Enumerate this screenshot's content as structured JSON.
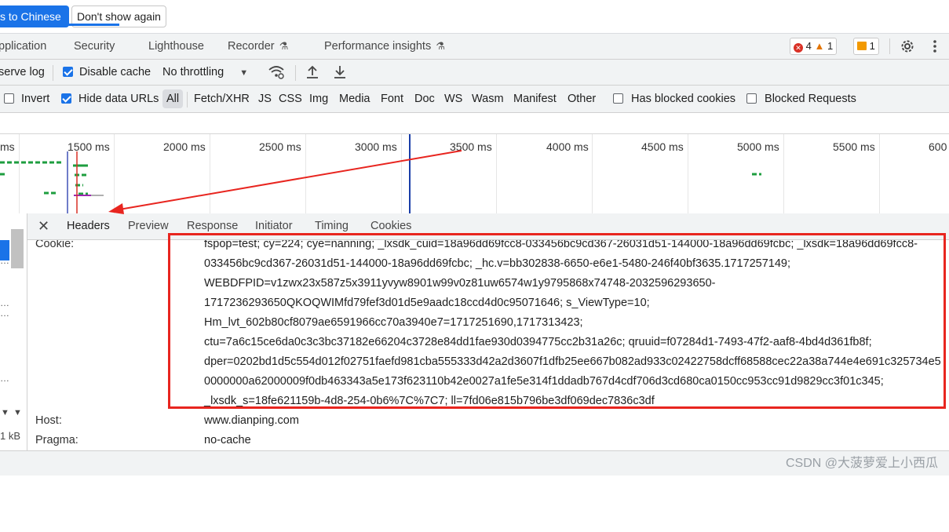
{
  "banner": {
    "switch_label": "s to Chinese",
    "dont_show_label": "Don't show again"
  },
  "panel_tabs": {
    "application": "pplication",
    "security": "Security",
    "lighthouse": "Lighthouse",
    "recorder": "Recorder",
    "performance_insights": "Performance insights",
    "errors_count": "4",
    "warnings_count": "1",
    "issues_count": "1"
  },
  "toolbar": {
    "preserve_log": "serve log",
    "disable_cache": "Disable cache",
    "throttling": "No throttling"
  },
  "filters": {
    "invert": "Invert",
    "hide_data_urls": "Hide data URLs",
    "all": "All",
    "types": [
      "Fetch/XHR",
      "JS",
      "CSS",
      "Img",
      "Media",
      "Font",
      "Doc",
      "WS",
      "Wasm",
      "Manifest",
      "Other"
    ],
    "has_blocked_cookies": "Has blocked cookies",
    "blocked_requests": "Blocked Requests"
  },
  "timeline": {
    "ticks": [
      "ms",
      "1500 ms",
      "2000 ms",
      "2500 ms",
      "3000 ms",
      "3500 ms",
      "4000 ms",
      "4500 ms",
      "5000 ms",
      "5500 ms",
      "600"
    ]
  },
  "detail_tabs": {
    "headers": "Headers",
    "preview": "Preview",
    "response": "Response",
    "initiator": "Initiator",
    "timing": "Timing",
    "cookies": "Cookies"
  },
  "left_list": {
    "size_text": "1 kB"
  },
  "headers": {
    "cookie_key": "Cookie:",
    "cookie_lines": [
      "fspop=test; cy=224; cye=nanning; _lxsdk_cuid=18a96dd69fcc8-033456bc9cd367-26031d51-144000-18a96dd69fcbc; _lxsdk=18a96dd69fcc8-",
      "033456bc9cd367-26031d51-144000-18a96dd69fcbc; _hc.v=bb302838-6650-e6e1-5480-246f40bf3635.1717257149;",
      "WEBDFPID=v1zwx23x587z5x3911yvyw8901w99v0z81uw6574w1y9795868x74748-2032596293650-",
      "1717236293650QKOQWIMfd79fef3d01d5e9aadc18ccd4d0c95071646; s_ViewType=10;",
      "Hm_lvt_602b80cf8079ae6591966cc70a3940e7=1717251690,1717313423;",
      "ctu=7a6c15ce6da0c3c3bc37182e66204c3728e84dd1fae930d0394775cc2b31a26c; qruuid=f07284d1-7493-47f2-aaf8-4bd4d361fb8f;",
      "dper=0202bd1d5c554d012f02751faefd981cba555333d42a2d3607f1dfb25ee667b082ad933c02422758dcff68588cec22a38a744e4e691c325734e5",
      "0000000a62000009f0db463343a5e173f623110b42e0027a1fe5e314f1ddadb767d4cdf706d3cd680ca0150cc953cc91d9829cc3f01c345;",
      "_lxsdk_s=18fe621159b-4d8-254-0b6%7C%7C7; ll=7fd06e815b796be3df069dec7836c3df"
    ],
    "host_key": "Host:",
    "host_value": "www.dianping.com",
    "pragma_key": "Pragma:",
    "pragma_value": "no-cache"
  },
  "watermark": "CSDN @大菠萝爱上小西瓜",
  "colors": {
    "accent": "#1a73e8",
    "annotation_red": "#e8251f",
    "panel_bg": "#f1f3f4"
  }
}
